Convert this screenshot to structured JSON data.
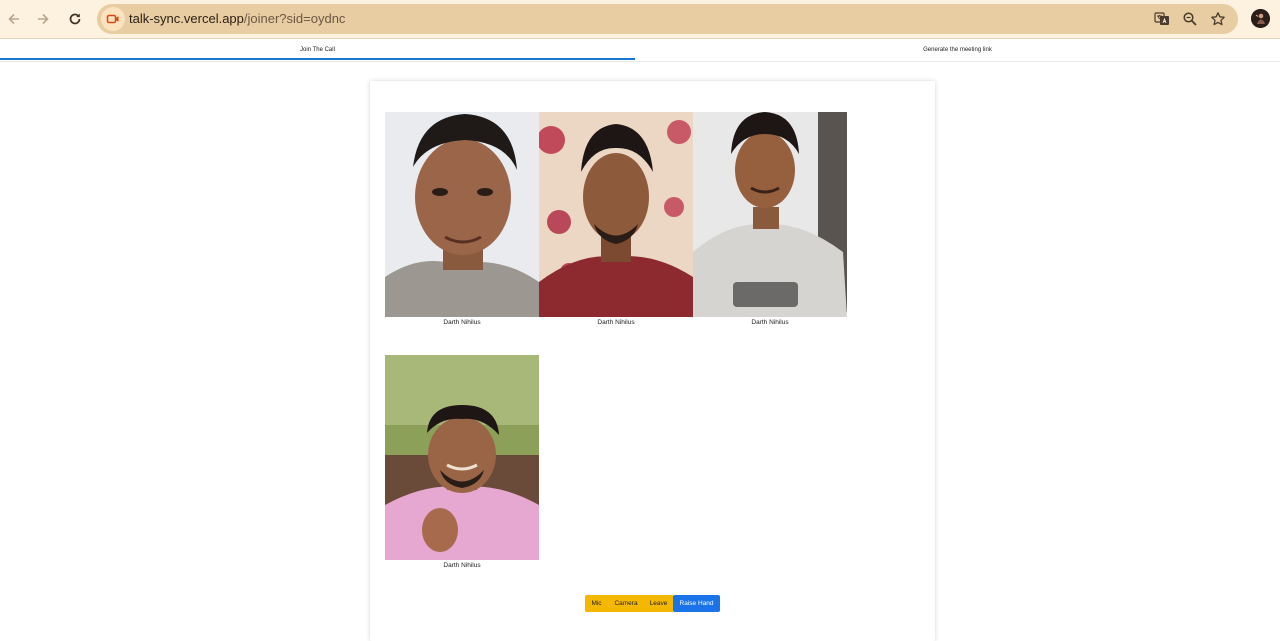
{
  "browser": {
    "url_host": "talk-sync.vercel.app",
    "url_path": "/joiner?sid=oydnc"
  },
  "tabs": [
    {
      "label": "Join The Call",
      "active": true
    },
    {
      "label": "Generate the meeting link",
      "active": false
    }
  ],
  "participants": [
    {
      "name": "Darth Nihilus"
    },
    {
      "name": "Darth Nihilus"
    },
    {
      "name": "Darth Nihilus"
    },
    {
      "name": "Darth Nihilus"
    }
  ],
  "controls": {
    "mic": "Mic",
    "camera": "Camera",
    "leave": "Leave",
    "raise_hand": "Raise Hand"
  },
  "colors": {
    "control_yellow": "#f5b800",
    "raise_blue": "#1a73e8",
    "tab_indicator": "#1976d2"
  }
}
